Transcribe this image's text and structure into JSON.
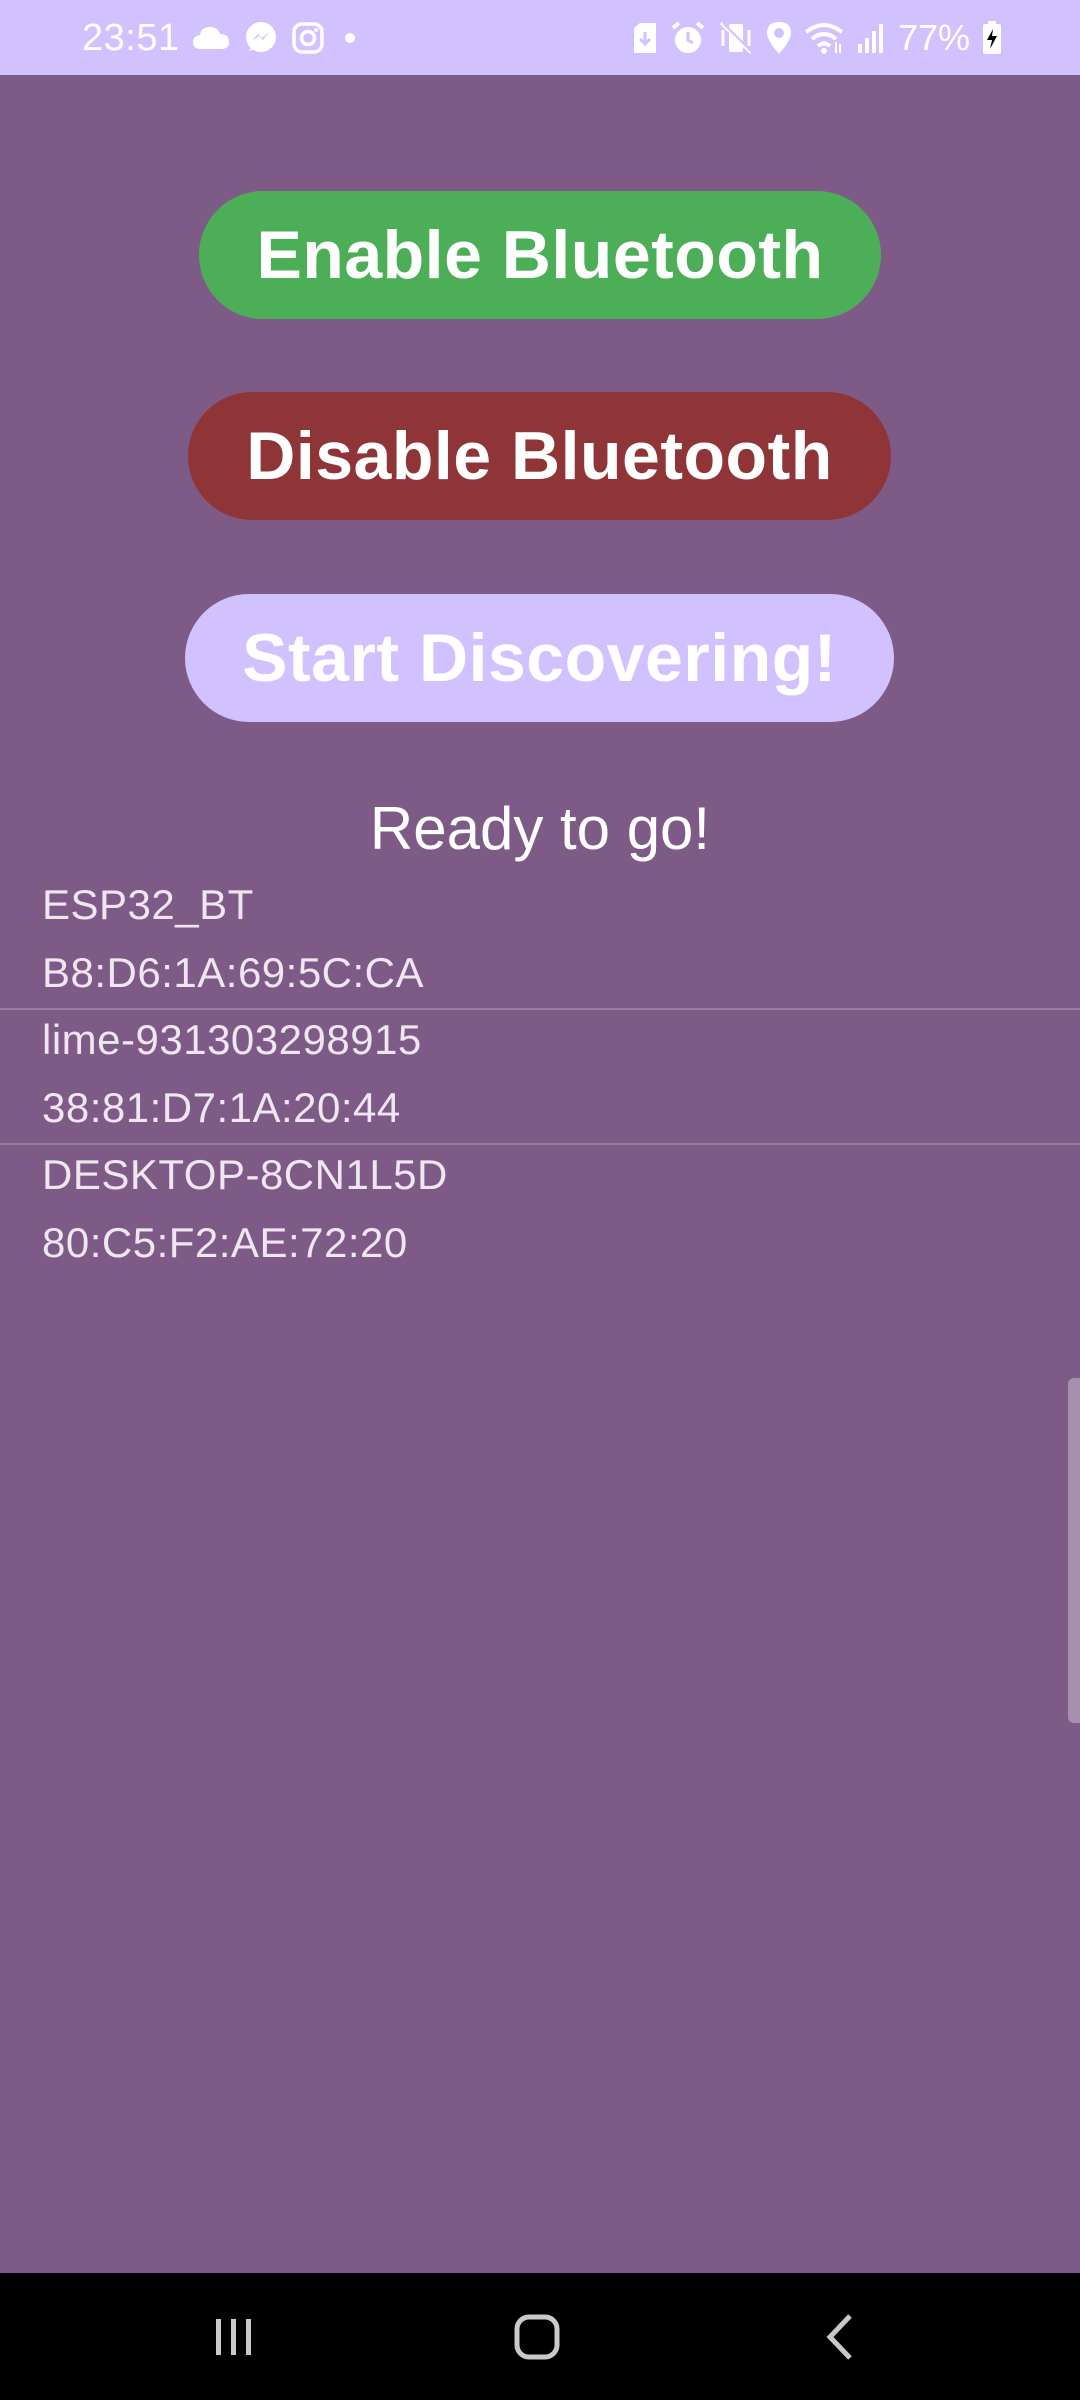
{
  "status_bar": {
    "time": "23:51",
    "battery_percent": "77%",
    "left_icons": [
      "cloud-icon",
      "messenger-icon",
      "instagram-icon",
      "dot-icon"
    ],
    "right_icons": [
      "save-icon",
      "alarm-icon",
      "vibrate-mute-icon",
      "location-icon",
      "wifi-icon",
      "signal-icon",
      "battery-charging-icon"
    ]
  },
  "colors": {
    "status_bar_bg": "#D2C1FF",
    "app_bg": "#7E5A86",
    "enable_button": "#4CAF58",
    "disable_button": "#8F3437",
    "discover_button": "#D2C1FF"
  },
  "buttons": {
    "enable": "Enable Bluetooth",
    "disable": "Disable Bluetooth",
    "discover": "Start Discovering!"
  },
  "status_message": "Ready to go!",
  "devices": [
    {
      "name": "ESP32_BT",
      "address": "B8:D6:1A:69:5C:CA"
    },
    {
      "name": "lime-931303298915",
      "address": "38:81:D7:1A:20:44"
    },
    {
      "name": "DESKTOP-8CN1L5D",
      "address": "80:C5:F2:AE:72:20"
    }
  ],
  "nav": [
    "recents-icon",
    "home-icon",
    "back-icon"
  ]
}
